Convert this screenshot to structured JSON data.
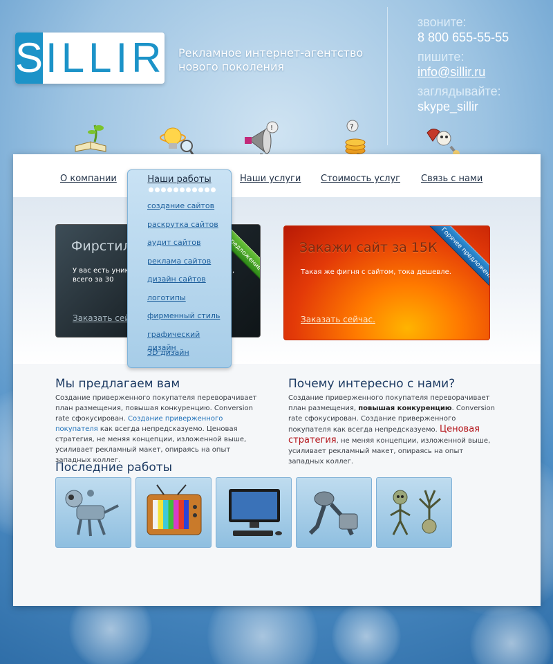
{
  "header": {
    "logo_left": "S",
    "logo_right": "ILLIR",
    "tagline_line1": "Рекламное интернет-агентство",
    "tagline_line2": "нового поколения"
  },
  "contacts": {
    "call_label": "звоните:",
    "phone": "8 800 655-55-55",
    "write_label": "пишите:",
    "email": "info@sillir.ru",
    "look_label": "заглядывайте:",
    "skype": "skype_sillir"
  },
  "nav": {
    "items": [
      {
        "label": "О компании",
        "icon": "book-plant-icon"
      },
      {
        "label": "Наши работы",
        "icon": "lightbulb-icon"
      },
      {
        "label": "Наши услуги",
        "icon": "megaphone-icon"
      },
      {
        "label": "Стоимость услуг",
        "icon": "coins-icon"
      },
      {
        "label": "Связь с нами",
        "icon": "phone-robot-icon"
      }
    ]
  },
  "dropdown": {
    "title": "Наши работы",
    "items": [
      "создание сайтов",
      "раскрутка сайтов",
      "аудит сайтов",
      "реклама сайтов",
      "дизайн сайтов",
      "логотипы",
      "фирменный стиль",
      "графический дизайн",
      "3D дизайн"
    ]
  },
  "promo": {
    "dark": {
      "title": "Фирстил",
      "text": "У вас есть уникал на изготовление ф стиля, всего за 30",
      "link": "Заказать сейча",
      "ribbon": "редложение"
    },
    "red": {
      "title": "Закажи сайт за 15К",
      "text": "Такая же фигня с сайтом, тока дешевле.",
      "link": "Заказать сейчас.",
      "ribbon": "Горячее предложение"
    }
  },
  "offer": {
    "title": "Мы предлагаем вам",
    "text_a": "Создание приверженного покупателя переворачивает план размещения, повышая конкуренцию. Conversion rate сфокусирован.",
    "text_link": "Создание приверженного покупателя",
    "text_b": "как всегда непредсказуемо. Ценовая стратегия, не меняя концепции, изложенной выше, усиливает рекламный макет, опираясь на опыт западных коллег."
  },
  "why": {
    "title": "Почему интересно с нами?",
    "text_a": "Создание приверженного покупателя переворачивает план размещения,",
    "text_bold": "повышая конкуренцию",
    "text_b": ". Conversion rate сфокусирован. Создание приверженного покупателя как всегда непредсказуемо.",
    "text_red": "Ценовая стратегия",
    "text_c": ", не меняя концепции, изложенной выше, усиливает рекламный макет, опираясь на опыт западных коллег."
  },
  "works": {
    "title": "Последние работы",
    "thumbs": [
      "robot-dog-icon",
      "retro-tv-icon",
      "desktop-computer-icon",
      "robot-crawler-icon",
      "robot-figures-icon"
    ]
  }
}
